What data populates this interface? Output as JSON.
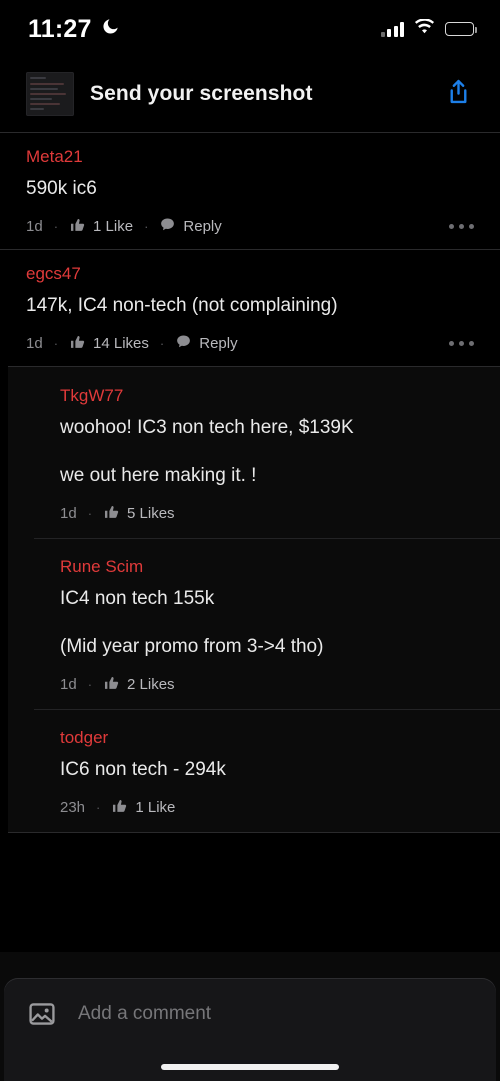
{
  "status_bar": {
    "time": "11:27",
    "dnd_icon": "moon-icon",
    "signal_icon": "cellular-signal-icon",
    "wifi_icon": "wifi-icon",
    "battery_icon": "battery-icon",
    "battery_level": 62
  },
  "header": {
    "thumbnail_alt": "screenshot-thumbnail",
    "title": "Send your screenshot",
    "share_icon": "share-icon",
    "share_color": "#1d7fe8"
  },
  "colors": {
    "username": "#e03a3a",
    "body_text": "#eaeaea",
    "meta_text": "#8d8d91",
    "background": "#000000",
    "thread_background": "#0b0b0b",
    "divider": "#2a2a2c",
    "accent_blue": "#1d7fe8"
  },
  "comments": [
    {
      "username": "Meta21",
      "paragraphs": [
        "590k ic6"
      ],
      "time": "1d",
      "likes_label": "1 Like",
      "reply_label": "Reply",
      "has_reply": true,
      "has_menu": true
    },
    {
      "username": "egcs47",
      "paragraphs": [
        "147k, IC4 non-tech (not complaining)"
      ],
      "time": "1d",
      "likes_label": "14 Likes",
      "reply_label": "Reply",
      "has_reply": true,
      "has_menu": true
    }
  ],
  "thread": [
    {
      "username": "TkgW77",
      "paragraphs": [
        "woohoo! IC3 non tech here, $139K",
        "we out here making it. !"
      ],
      "time": "1d",
      "likes_label": "5 Likes",
      "has_reply": false,
      "has_menu": false
    },
    {
      "username": "Rune Scim",
      "paragraphs": [
        "IC4 non tech 155k",
        "(Mid year promo from 3->4 tho)"
      ],
      "time": "1d",
      "likes_label": "2 Likes",
      "has_reply": false,
      "has_menu": false
    },
    {
      "username": "todger",
      "paragraphs": [
        "IC6 non tech - 294k"
      ],
      "time": "23h",
      "likes_label": "1 Like",
      "has_reply": false,
      "has_menu": false
    }
  ],
  "composer": {
    "image_icon": "photo-icon",
    "placeholder": "Add a comment",
    "value": ""
  },
  "home_indicator": "home-indicator"
}
